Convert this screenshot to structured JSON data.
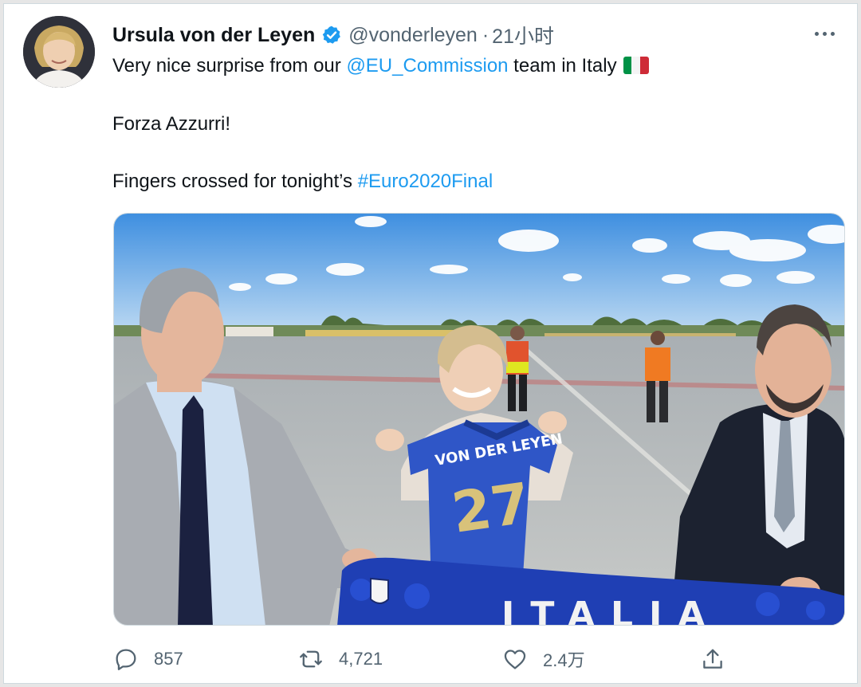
{
  "tweet": {
    "author_name": "Ursula von der Leyen",
    "handle": "@vonderleyen",
    "separator": "·",
    "time": "21小时",
    "line1_prefix": "Very nice surprise from our ",
    "line1_mention": "@EU_Commission",
    "line1_suffix": " team in Italy",
    "flag_colors": [
      "#009246",
      "#ffffff",
      "#ce2b37"
    ],
    "line2": "Forza Azzurri!",
    "line3_prefix": "Fingers crossed for tonight’s ",
    "line3_hashtag": "#Euro2020Final",
    "photo_jersey_name": "VON DER LEYEN",
    "photo_jersey_number": "27",
    "photo_scarf_text": "ITALIA"
  },
  "actions": {
    "reply_count": "857",
    "retweet_count": "4,721",
    "like_count": "2.4万"
  },
  "colors": {
    "link": "#1d9bf0",
    "muted": "#536471",
    "verified": "#1d9bf0"
  },
  "icons": {
    "verified": "verified-badge-icon",
    "more": "more-icon",
    "reply": "reply-icon",
    "retweet": "retweet-icon",
    "like": "heart-icon",
    "share": "share-icon"
  }
}
